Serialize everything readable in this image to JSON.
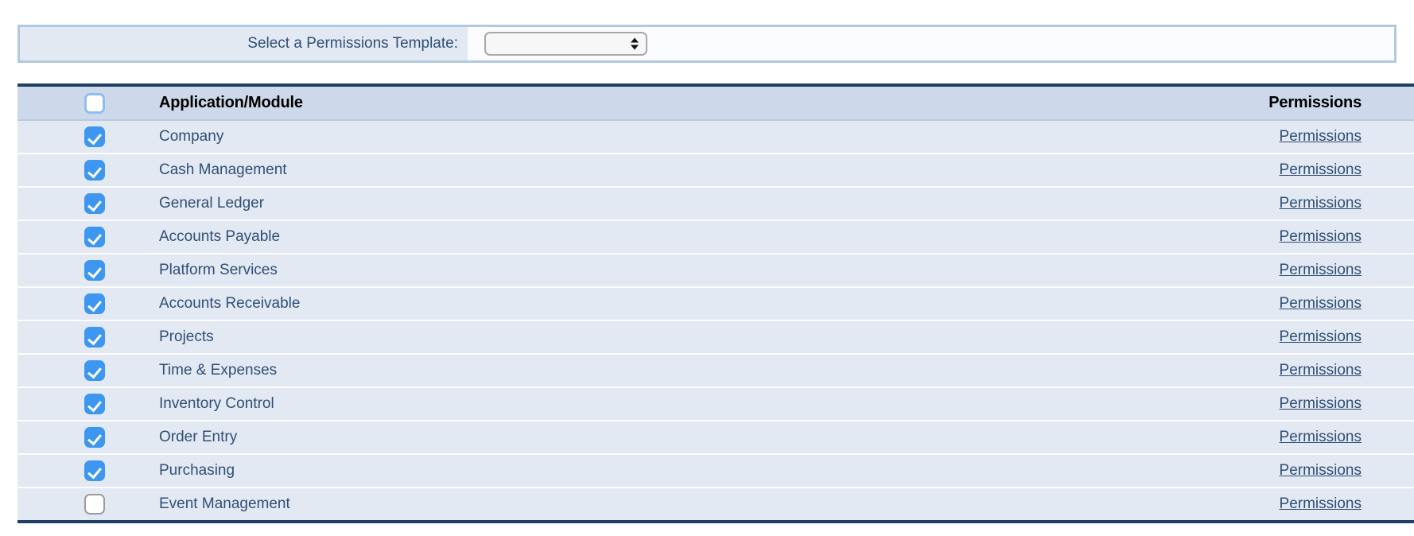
{
  "colors": {
    "accent_blue": "#3d96f0",
    "label_text": "#2f4f76",
    "header_bg": "#cdd9ea",
    "row_bg": "#e3e9f3",
    "table_border": "#1f3f64",
    "panel_border": "#b3c9e0"
  },
  "template_selector": {
    "label": "Select a Permissions Template:",
    "select": {
      "value": "",
      "placeholder": "",
      "options": [],
      "stepper_up_icon": "triangle-up-icon",
      "stepper_down_icon": "triangle-down-icon"
    }
  },
  "table": {
    "columns": {
      "select_all": {
        "checked": false,
        "icon": "checkbox-icon"
      },
      "module": "Application/Module",
      "permissions": "Permissions"
    },
    "rows": [
      {
        "checked": true,
        "module": "Company",
        "permissions_link": "Permissions"
      },
      {
        "checked": true,
        "module": "Cash Management",
        "permissions_link": "Permissions"
      },
      {
        "checked": true,
        "module": "General Ledger",
        "permissions_link": "Permissions"
      },
      {
        "checked": true,
        "module": "Accounts Payable",
        "permissions_link": "Permissions"
      },
      {
        "checked": true,
        "module": "Platform Services",
        "permissions_link": "Permissions"
      },
      {
        "checked": true,
        "module": "Accounts Receivable",
        "permissions_link": "Permissions"
      },
      {
        "checked": true,
        "module": "Projects",
        "permissions_link": "Permissions"
      },
      {
        "checked": true,
        "module": "Time & Expenses",
        "permissions_link": "Permissions"
      },
      {
        "checked": true,
        "module": "Inventory Control",
        "permissions_link": "Permissions"
      },
      {
        "checked": true,
        "module": "Order Entry",
        "permissions_link": "Permissions"
      },
      {
        "checked": true,
        "module": "Purchasing",
        "permissions_link": "Permissions"
      },
      {
        "checked": false,
        "module": "Event Management",
        "permissions_link": "Permissions"
      }
    ]
  }
}
